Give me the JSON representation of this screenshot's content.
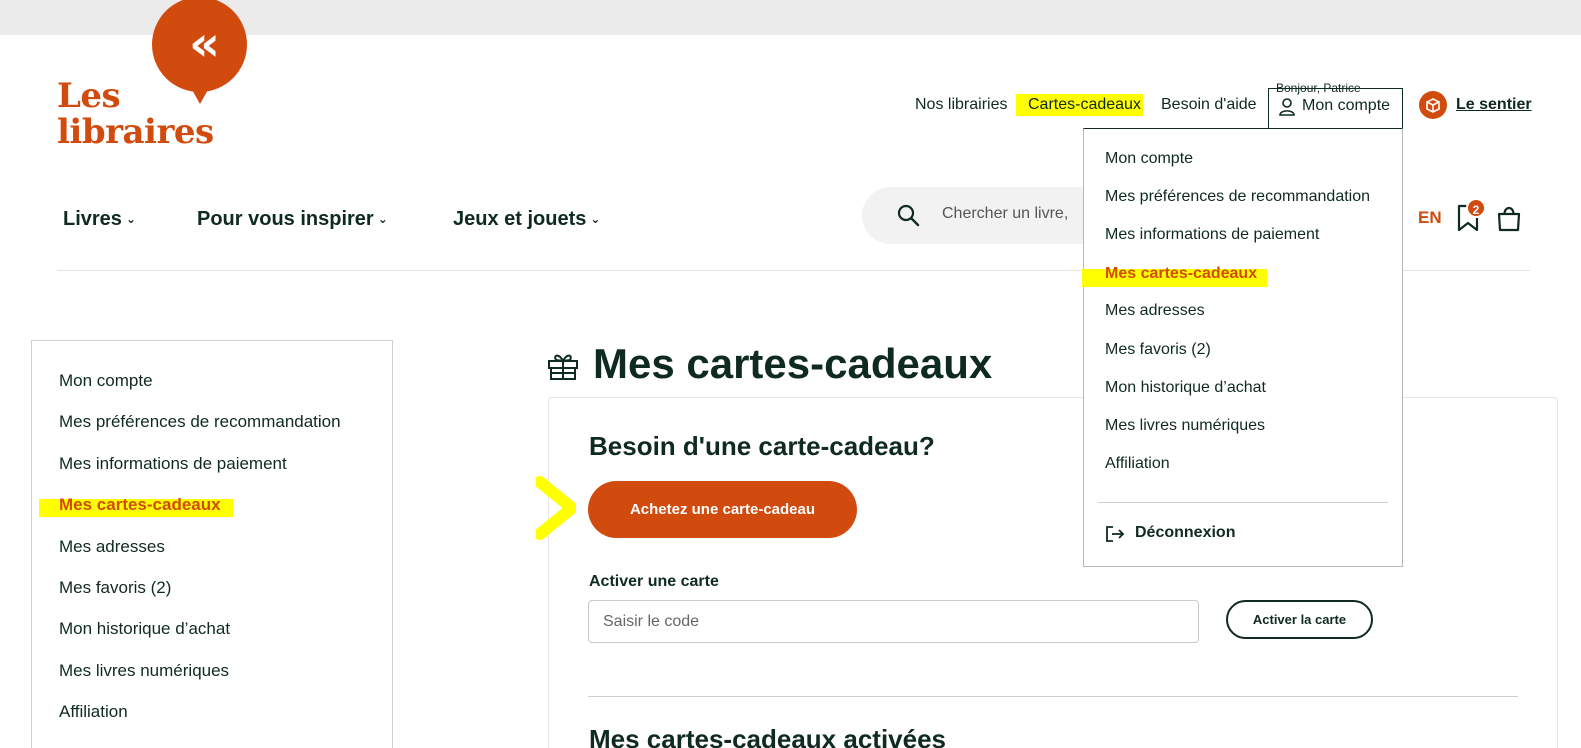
{
  "brand": {
    "line1": "Les",
    "line2": "libraires",
    "mark": "«",
    "color": "#d24b0e"
  },
  "header": {
    "links": [
      "Nos librairies",
      "Cartes-cadeaux",
      "Besoin d'aide"
    ],
    "greeting": "Bonjour, Patrice",
    "account_label": "Mon compte",
    "sentier_label": "Le sentier"
  },
  "nav": {
    "items": [
      "Livres",
      "Pour vous inspirer",
      "Jeux et jouets"
    ],
    "search_placeholder": "Chercher un livre,",
    "lang": "EN",
    "bookmark_count": "2",
    "icons": {
      "search": "search-icon",
      "bookmark": "bookmark-icon",
      "bag": "shopping-bag-icon"
    }
  },
  "sidebar": {
    "items": [
      "Mon compte",
      "Mes préférences de recommandation",
      "Mes informations de paiement",
      "Mes cartes-cadeaux",
      "Mes adresses",
      "Mes favoris (2)",
      "Mon historique d’achat",
      "Mes livres numériques",
      "Affiliation"
    ],
    "active_index": 3
  },
  "main": {
    "title": "Mes cartes-cadeaux",
    "need_title": "Besoin d'une carte-cadeau?",
    "buy_button": "Achetez une carte-cadeau",
    "activate_label": "Activer une carte",
    "code_placeholder": "Saisir le code",
    "activate_button": "Activer la carte",
    "activated_title": "Mes cartes-cadeaux activées"
  },
  "dropdown": {
    "items": [
      "Mon compte",
      "Mes préférences de recommandation",
      "Mes informations de paiement",
      "Mes cartes-cadeaux",
      "Mes adresses",
      "Mes favoris (2)",
      "Mon historique d’achat",
      "Mes livres numériques",
      "Affiliation"
    ],
    "active_index": 3,
    "logout": "Déconnexion"
  },
  "colors": {
    "accent": "#d24b0e",
    "text": "#0f2a22",
    "highlight": "#ffff00"
  }
}
